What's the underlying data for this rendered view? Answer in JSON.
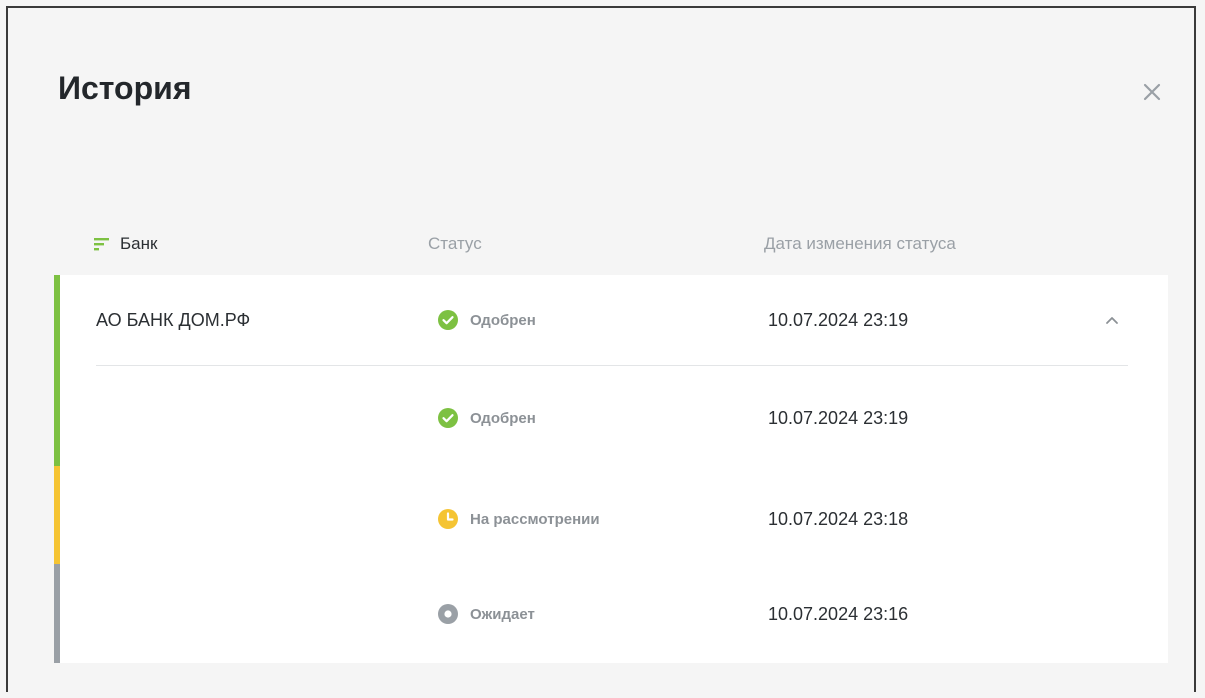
{
  "title": "История",
  "columns": {
    "bank": "Банк",
    "status": "Статус",
    "date": "Дата изменения статуса"
  },
  "rows": [
    {
      "bank": "АО БАНК ДОМ.РФ",
      "status": "Одобрен",
      "status_icon": "check-circle-icon",
      "color": "#7dc142",
      "date": "10.07.2024 23:19"
    },
    {
      "bank": "",
      "status": "Одобрен",
      "status_icon": "check-circle-icon",
      "color": "#7dc142",
      "date": "10.07.2024 23:19"
    },
    {
      "bank": "",
      "status": "На рассмотрении",
      "status_icon": "clock-icon",
      "color": "#f5c433",
      "date": "10.07.2024 23:18"
    },
    {
      "bank": "",
      "status": "Ожидает",
      "status_icon": "pending-dot-icon",
      "color": "#9aa0a6",
      "date": "10.07.2024 23:16"
    }
  ],
  "colors": {
    "approved": "#7dc142",
    "review": "#f5c433",
    "waiting": "#9aa0a6",
    "filter": "#7dc142"
  }
}
